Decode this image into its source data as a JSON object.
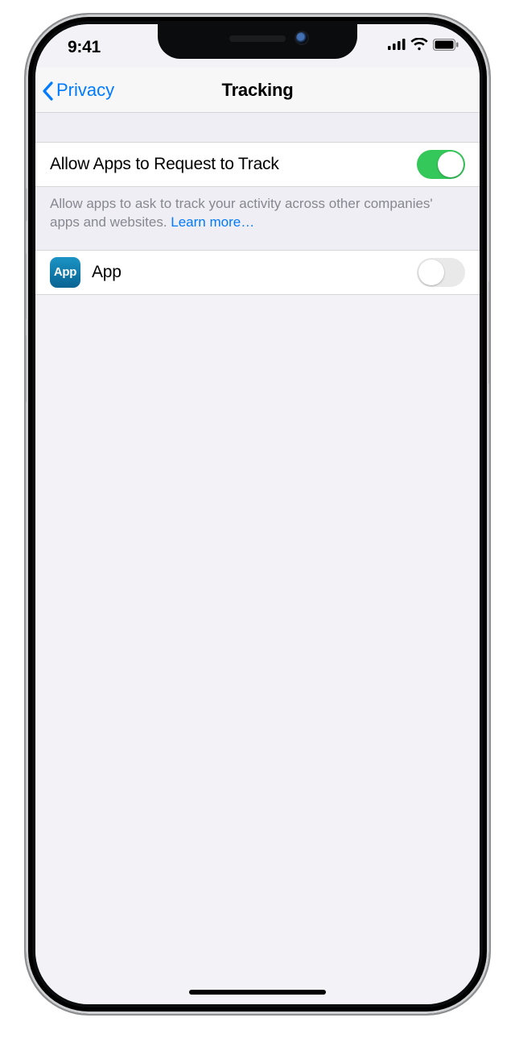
{
  "statusbar": {
    "time": "9:41"
  },
  "nav": {
    "back_label": "Privacy",
    "title": "Tracking"
  },
  "main_toggle": {
    "label": "Allow Apps to Request to Track",
    "on": true
  },
  "footer": {
    "text": "Allow apps to ask to track your activity across other companies' apps and websites. ",
    "link_text": "Learn more…"
  },
  "apps": [
    {
      "icon_label": "App",
      "name": "App",
      "on": false
    }
  ]
}
